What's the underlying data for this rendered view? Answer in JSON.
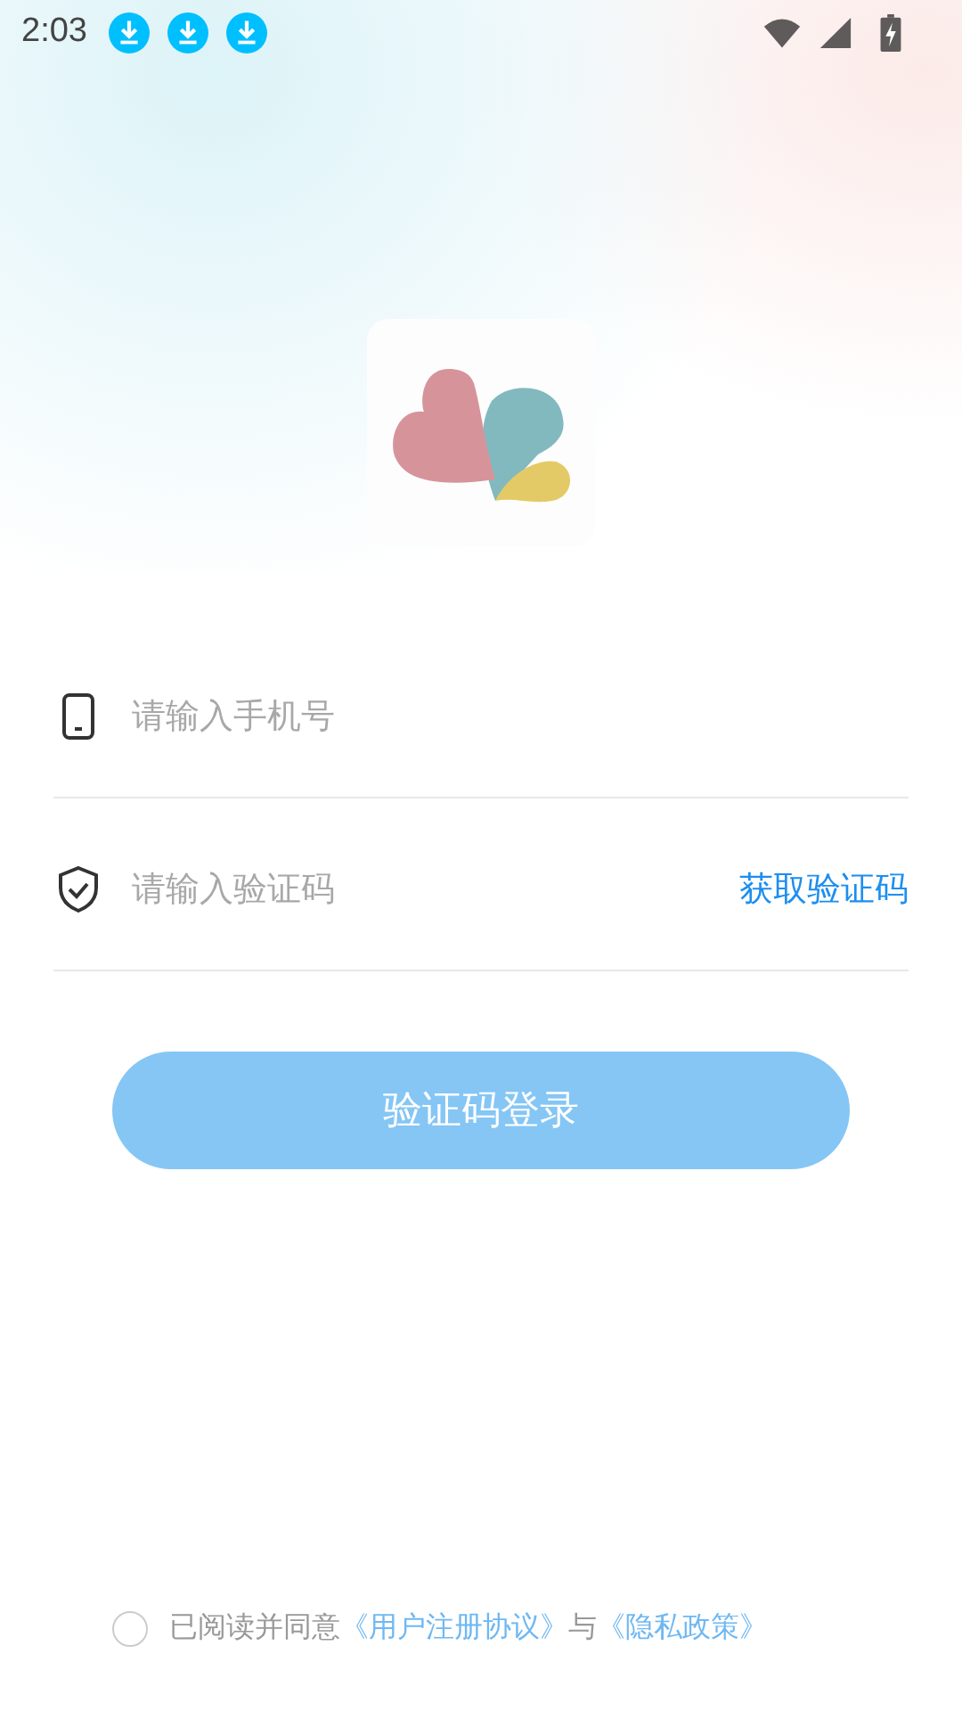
{
  "status_bar": {
    "time": "2:03"
  },
  "phone_field": {
    "placeholder": "请输入手机号"
  },
  "code_field": {
    "placeholder": "请输入验证码",
    "action": "获取验证码"
  },
  "login_button": {
    "label": "验证码登录",
    "disabled": true
  },
  "agreement": {
    "checked": false,
    "text": "已阅读并同意",
    "user_agreement": "《用户注册协议》",
    "joiner": "与",
    "privacy_policy": "《隐私政策》"
  }
}
